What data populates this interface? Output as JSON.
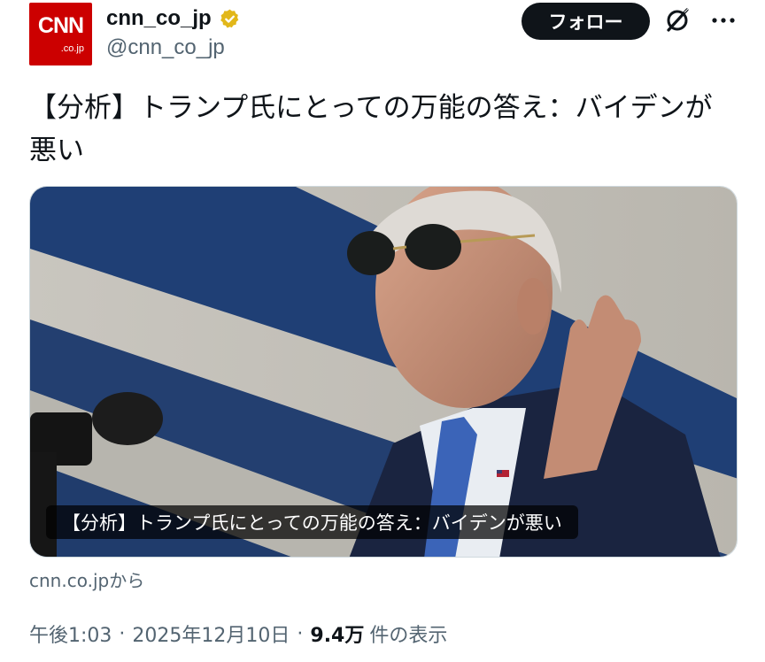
{
  "post": {
    "author": {
      "display_name": "cnn_co_jp",
      "handle": "@cnn_co_jp",
      "avatar_logo": "CNN",
      "avatar_sub": ".co.jp",
      "verified_color": "#e2b719"
    },
    "follow_label": "フォロー",
    "text": "【分析】トランプ氏にとっての万能の答え：バイデンが悪い",
    "card": {
      "caption": "【分析】トランプ氏にとっての万能の答え：バイデンが悪い"
    },
    "source": "cnn.co.jpから",
    "time": "午後1:03",
    "date": "2025年12月10日",
    "separator": "·",
    "views_count": "9.4万",
    "views_label": "件の表示"
  },
  "icons": {
    "verified": "verified-badge-icon",
    "grok": "grok-icon",
    "more": "more-icon"
  },
  "colors": {
    "brand": "#cc0000",
    "follow_bg": "#0f1419",
    "secondary_text": "#536471"
  }
}
